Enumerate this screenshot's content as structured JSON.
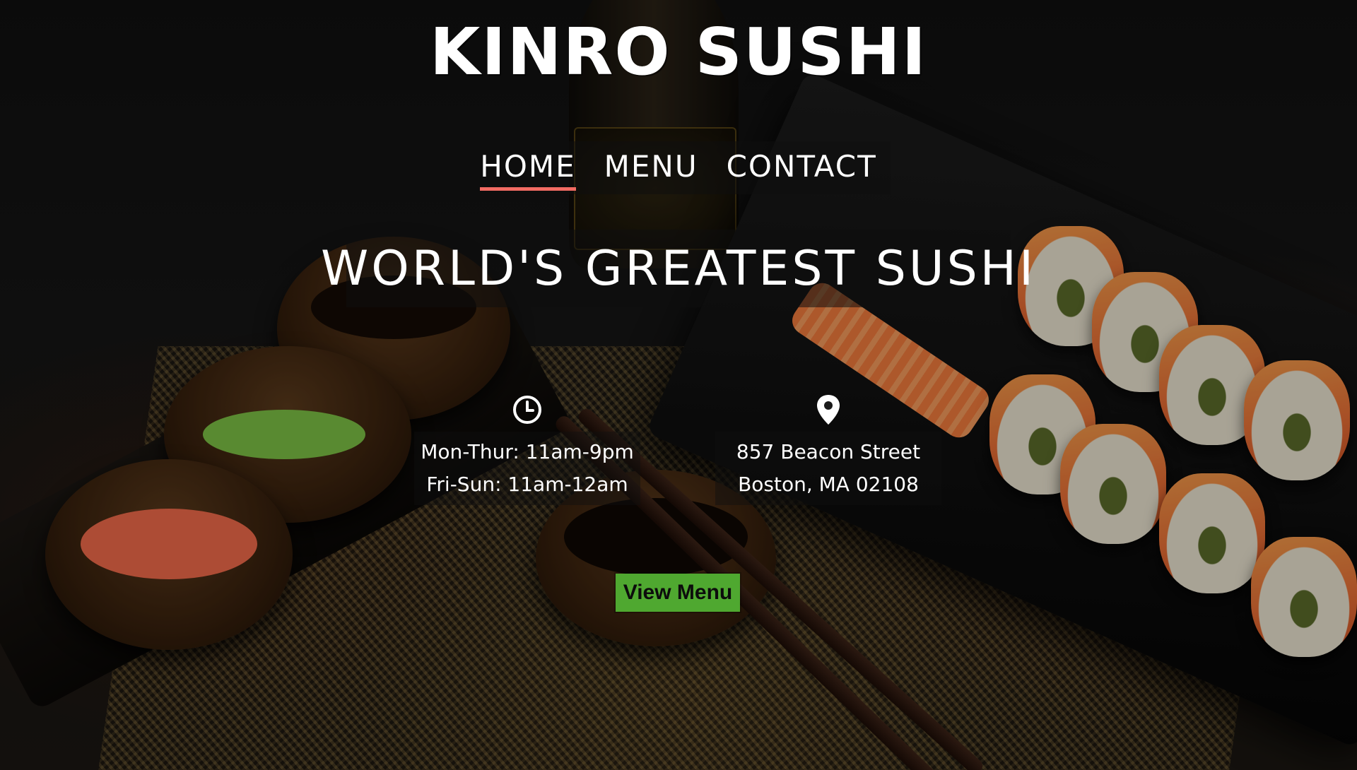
{
  "site": {
    "logo": "Kinro Sushi"
  },
  "nav": {
    "items": [
      {
        "label": "HOME",
        "active": true
      },
      {
        "label": "MENU",
        "active": false
      },
      {
        "label": "CONTACT",
        "active": false
      }
    ],
    "active_color": "#f26b63"
  },
  "hero": {
    "title": "WORLD'S GREATEST SUSHI"
  },
  "hours": {
    "icon": "clock-icon",
    "line1": "Mon-Thur: 11am-9pm",
    "line2": "Fri-Sun: 11am-12am"
  },
  "address": {
    "icon": "map-pin-icon",
    "line1": "857 Beacon Street",
    "line2": "Boston, MA 02108"
  },
  "cta": {
    "label": "View Menu",
    "color": "#4fa830"
  }
}
